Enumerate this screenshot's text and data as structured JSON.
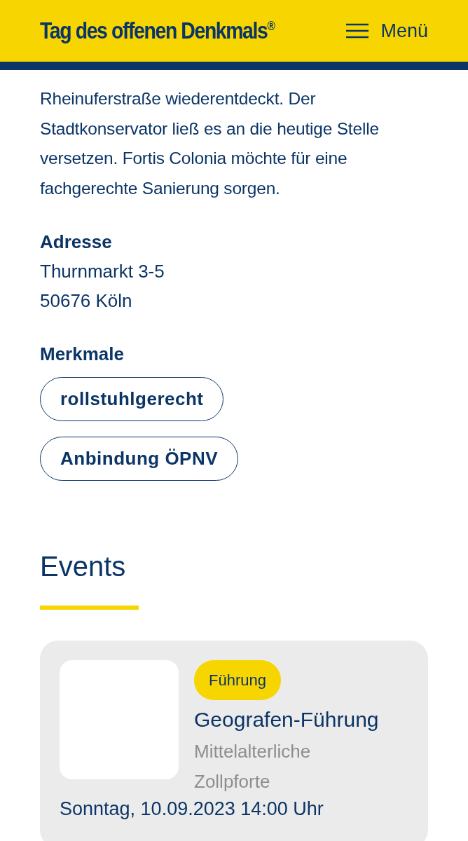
{
  "header": {
    "logo": "Tag des offenen Denkmals",
    "logo_mark": "®",
    "menu_label": "Menü"
  },
  "description": "Rheinuferstraße wiederentdeckt. Der Stadtkonservator ließ es an die heutige Stelle versetzen. Fortis Colonia möchte für eine fachgerechte Sanierung sorgen.",
  "address": {
    "heading": "Adresse",
    "lines": [
      "Thurnmarkt 3-5",
      "50676 Köln"
    ]
  },
  "features": {
    "heading": "Merkmale",
    "tags": [
      "rollstuhlgerecht",
      "Anbindung ÖPNV"
    ]
  },
  "events": {
    "heading": "Events",
    "items": [
      {
        "category": "Führung",
        "title": "Geografen-Führung",
        "location": "Mittelalterliche Zollpforte",
        "date": "Sonntag, 10.09.2023 14:00 Uhr"
      }
    ]
  }
}
